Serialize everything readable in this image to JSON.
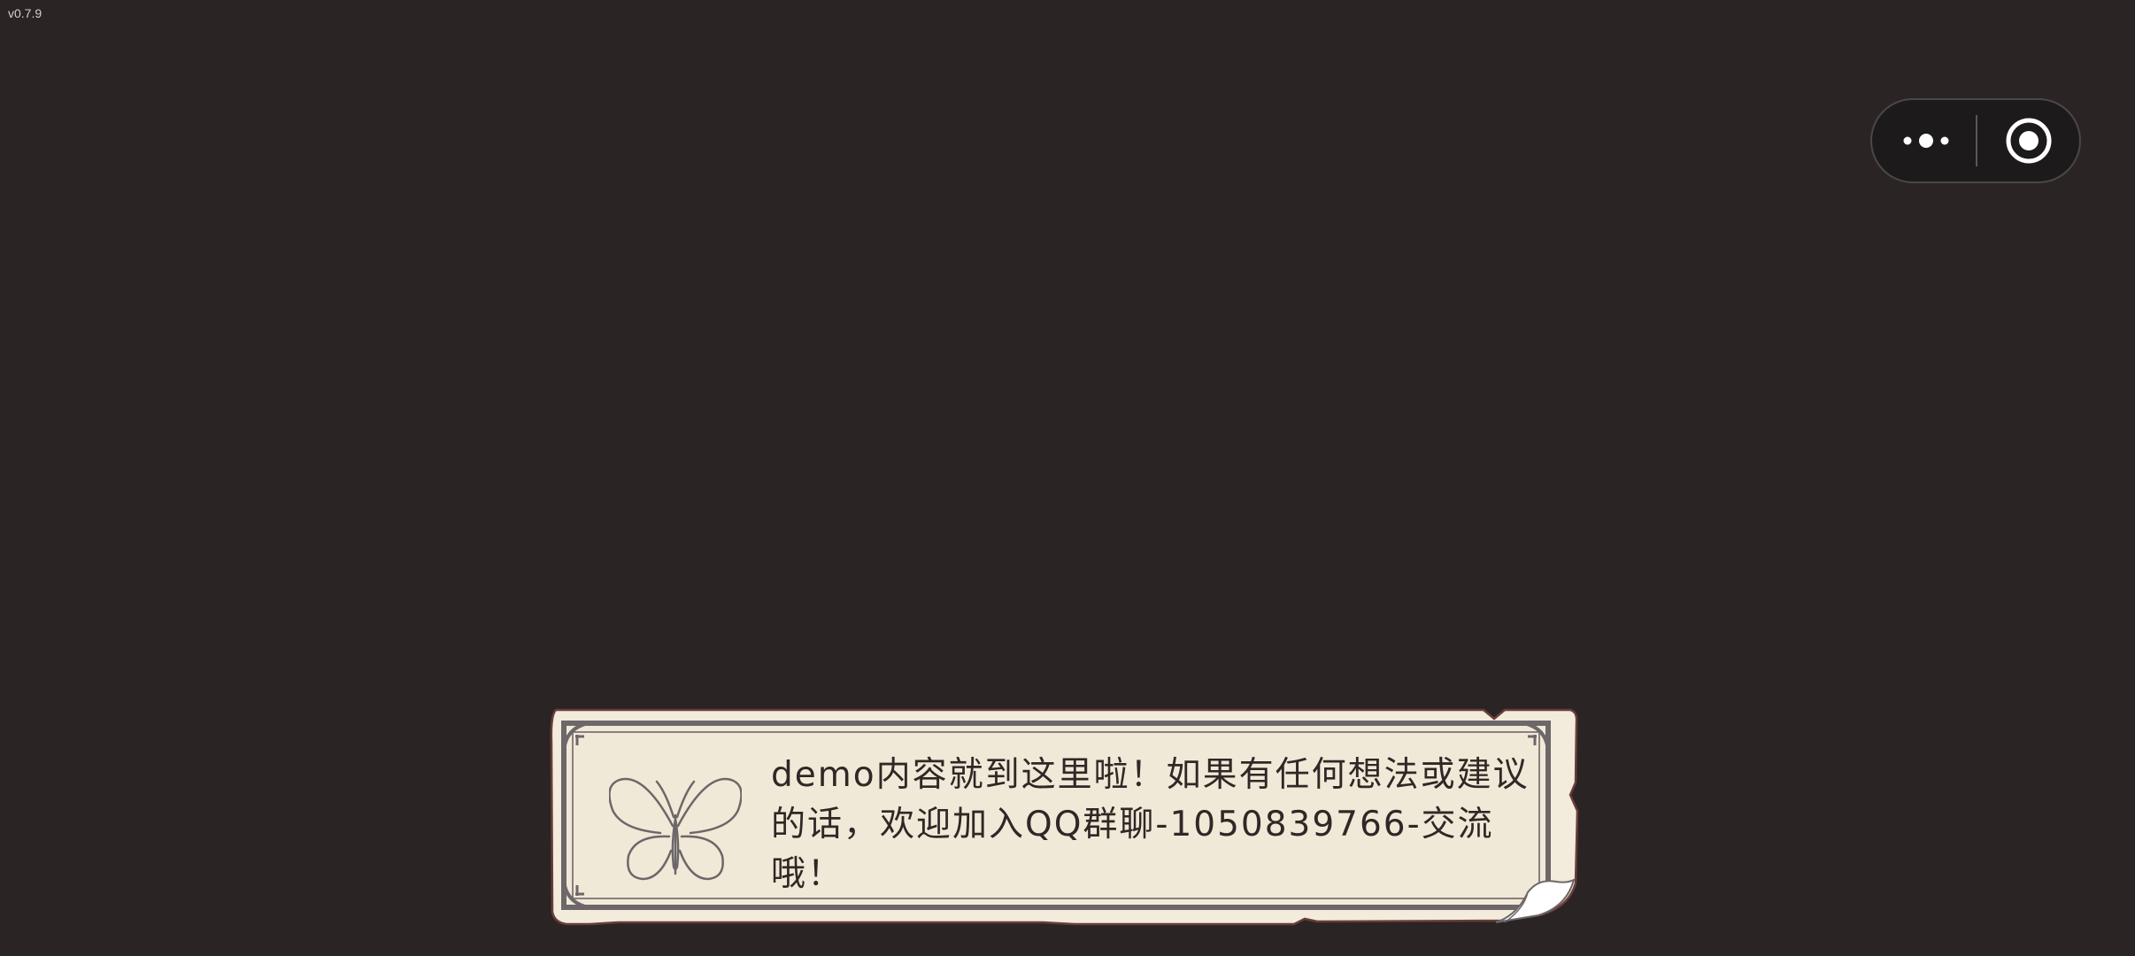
{
  "version_label": "v0.7.9",
  "capsule": {
    "menu_icon": "more-dots-icon",
    "close_icon": "target-circle-icon"
  },
  "dialog": {
    "message": "demo内容就到这里啦！如果有任何想法或建议的话，欢迎加入QQ群聊-1050839766-交流哦！",
    "icon": "butterfly-icon"
  },
  "colors": {
    "background": "#2a2424",
    "paper": "#f3ecdc",
    "paper_border": "#6a3d3a",
    "frame_line": "#6d6769",
    "text": "#2e2826",
    "capsule_bg": "#1c1a1b"
  }
}
